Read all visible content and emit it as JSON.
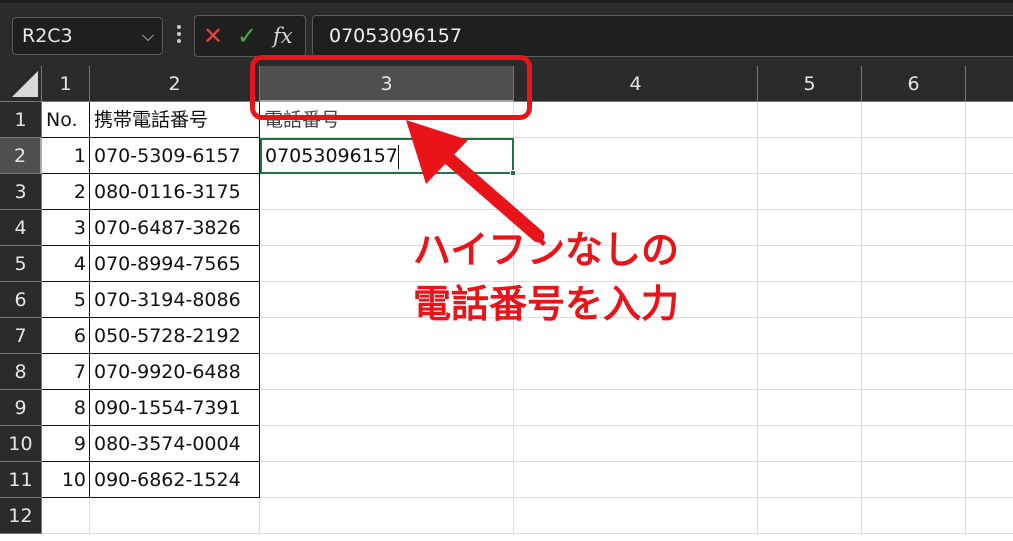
{
  "formula_bar": {
    "name_box": "R2C3",
    "chevron_glyph": "⌵",
    "cancel_glyph": "✕",
    "enter_glyph": "✓",
    "fx_glyph": "fx",
    "formula": "07053096157"
  },
  "columns": [
    {
      "label": "1",
      "selected": false
    },
    {
      "label": "2",
      "selected": false
    },
    {
      "label": "3",
      "selected": true
    },
    {
      "label": "4",
      "selected": false
    },
    {
      "label": "5",
      "selected": false
    },
    {
      "label": "6",
      "selected": false
    }
  ],
  "rows": [
    "1",
    "2",
    "3",
    "4",
    "5",
    "6",
    "7",
    "8",
    "9",
    "10",
    "11",
    "12"
  ],
  "selected_row": "2",
  "headers": {
    "c1": "No.",
    "c2": "携帯電話番号",
    "c3": "電話番号"
  },
  "data_rows": [
    {
      "no": "1",
      "mobile": "070-5309-6157"
    },
    {
      "no": "2",
      "mobile": "080-0116-3175"
    },
    {
      "no": "3",
      "mobile": "070-6487-3826"
    },
    {
      "no": "4",
      "mobile": "070-8994-7565"
    },
    {
      "no": "5",
      "mobile": "070-3194-8086"
    },
    {
      "no": "6",
      "mobile": "050-5728-2192"
    },
    {
      "no": "7",
      "mobile": "070-9920-6488"
    },
    {
      "no": "8",
      "mobile": "090-1554-7391"
    },
    {
      "no": "9",
      "mobile": "080-3574-0004"
    },
    {
      "no": "10",
      "mobile": "090-6862-1524"
    }
  ],
  "active_cell": {
    "value": "07053096157"
  },
  "annotation": {
    "line1": "ハイフンなしの",
    "line2": "電話番号を入力",
    "color": "#e8141a"
  },
  "colors": {
    "accent": "#217346",
    "header_bg": "#2b2b2b"
  }
}
